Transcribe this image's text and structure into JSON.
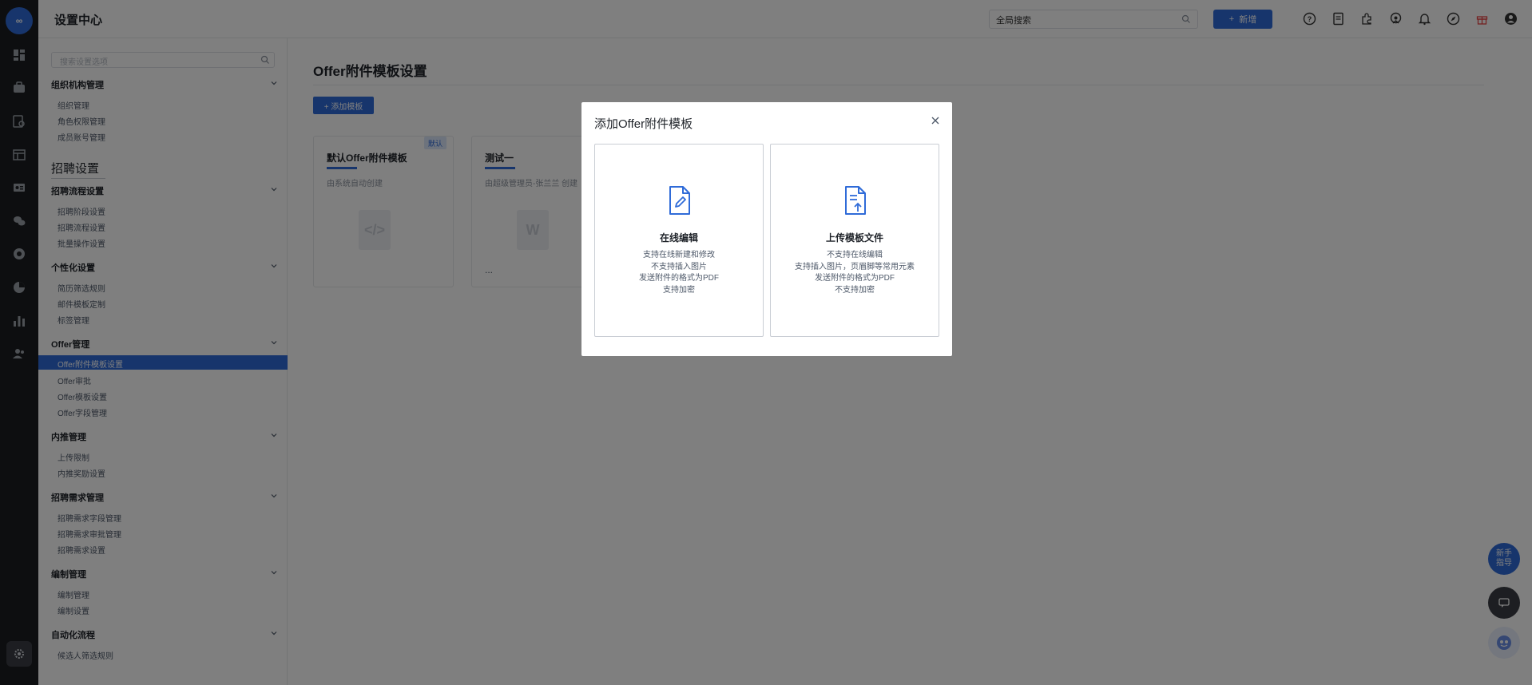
{
  "app": {
    "logo_text": "∞"
  },
  "header": {
    "title": "设置中心",
    "search_value": "全局搜索",
    "add_label": "新增"
  },
  "sidenav": {
    "search_placeholder": "搜索设置选项",
    "groups": [
      {
        "label": "组织机构管理",
        "items": [
          "组织管理",
          "角色权限管理",
          "成员账号管理"
        ]
      },
      {
        "label": "招聘流程设置",
        "items": [
          "招聘阶段设置",
          "招聘流程设置",
          "批量操作设置"
        ]
      },
      {
        "label": "个性化设置",
        "items": [
          "简历筛选规则",
          "邮件模板定制",
          "标签管理"
        ]
      },
      {
        "label": "Offer管理",
        "items": [
          "Offer附件模板设置",
          "Offer审批",
          "Offer模板设置",
          "Offer字段管理"
        ]
      },
      {
        "label": "内推管理",
        "items": [
          "上传限制",
          "内推奖励设置"
        ]
      },
      {
        "label": "招聘需求管理",
        "items": [
          "招聘需求字段管理",
          "招聘需求审批管理",
          "招聘需求设置"
        ]
      },
      {
        "label": "编制管理",
        "items": [
          "编制管理",
          "编制设置"
        ]
      },
      {
        "label": "自动化流程",
        "items": [
          "候选人筛选规则"
        ]
      }
    ],
    "section_label": "招聘设置",
    "active_item": "Offer附件模板设置"
  },
  "main": {
    "page_title": "Offer附件模板设置",
    "add_template_label": "+ 添加模板",
    "templates": [
      {
        "name": "默认Offer附件模板",
        "desc": "由系统自动创建",
        "badge": "默认",
        "file_glyph": "</>"
      },
      {
        "name": "测试一",
        "desc": "由超级管理员-张兰兰 创建",
        "badge": "",
        "file_glyph": "W",
        "more": "..."
      }
    ]
  },
  "float_buttons": {
    "guide_label": "新手指导"
  },
  "modal": {
    "title": "添加Offer附件模板",
    "options": [
      {
        "name": "在线编辑",
        "lines": [
          "支持在线新建和修改",
          "不支持插入图片",
          "发送附件的格式为PDF",
          "支持加密"
        ],
        "icon": "edit-document-icon"
      },
      {
        "name": "上传模板文件",
        "lines": [
          "不支持在线编辑",
          "支持插入图片，页眉脚等常用元素",
          "发送附件的格式为PDF",
          "不支持加密"
        ],
        "icon": "upload-document-icon"
      }
    ]
  },
  "colors": {
    "accent": "#2f6bd8",
    "rail": "#1b1d21",
    "gift": "#e64545"
  }
}
